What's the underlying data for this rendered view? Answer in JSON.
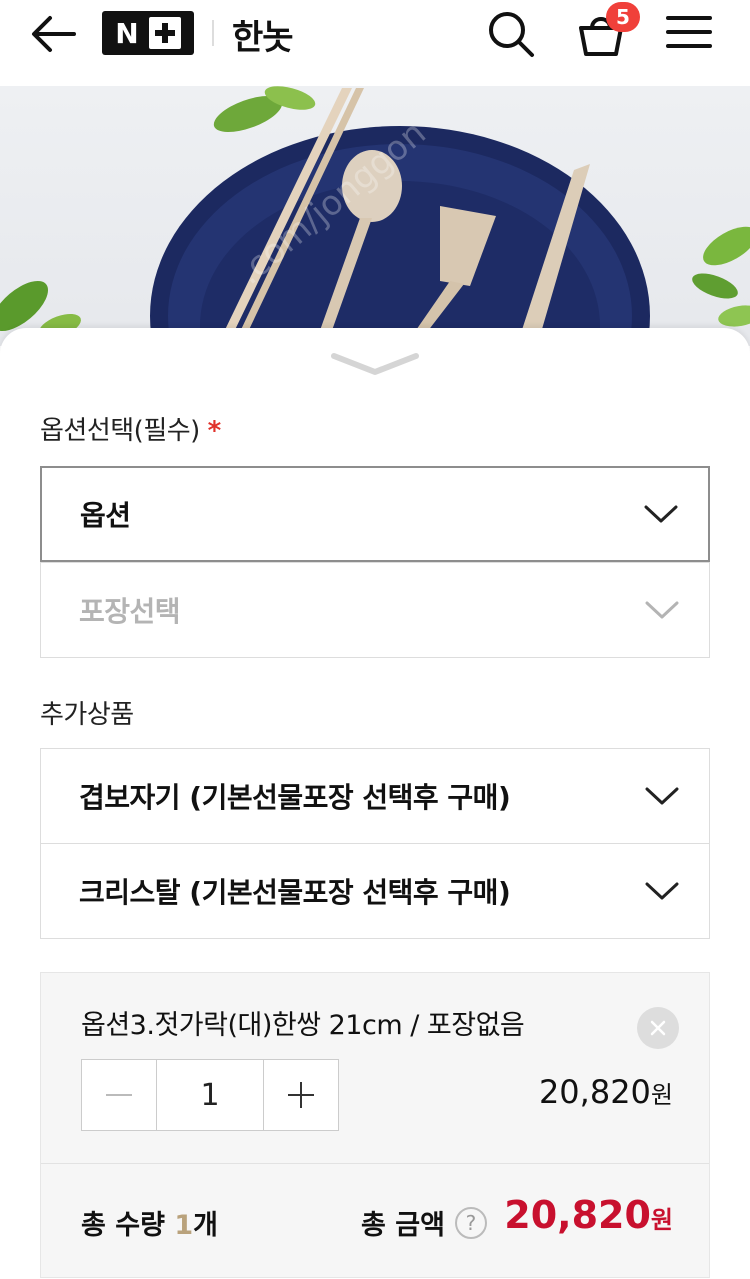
{
  "header": {
    "logo_text": "N+",
    "store_name": "한놋",
    "cart_count": "5"
  },
  "hero": {
    "watermark": ".com/jonggon"
  },
  "options": {
    "section_label": "옵션선택(필수)",
    "required_mark": "*",
    "select_option_label": "옵션",
    "select_packaging_label": "포장선택"
  },
  "addons": {
    "section_label": "추가상품",
    "items": [
      {
        "label": "겹보자기 (기본선물포장 선택후 구매)"
      },
      {
        "label": "크리스탈 (기본선물포장 선택후 구매)"
      }
    ]
  },
  "selected_item": {
    "name": "옵션3.젓가락(대)한쌍 21cm / 포장없음",
    "quantity": "1",
    "price": "20,820",
    "price_unit": "원"
  },
  "summary": {
    "total_qty_label": "총 수량",
    "total_qty_value": "1",
    "total_qty_unit": "개",
    "total_amount_label": "총 금액",
    "help_symbol": "?",
    "total_amount": "20,820",
    "total_amount_unit": "원"
  },
  "colors": {
    "accent_red": "#c8102e",
    "badge_red": "#f0403a",
    "qty_gold": "#b9a27c"
  }
}
